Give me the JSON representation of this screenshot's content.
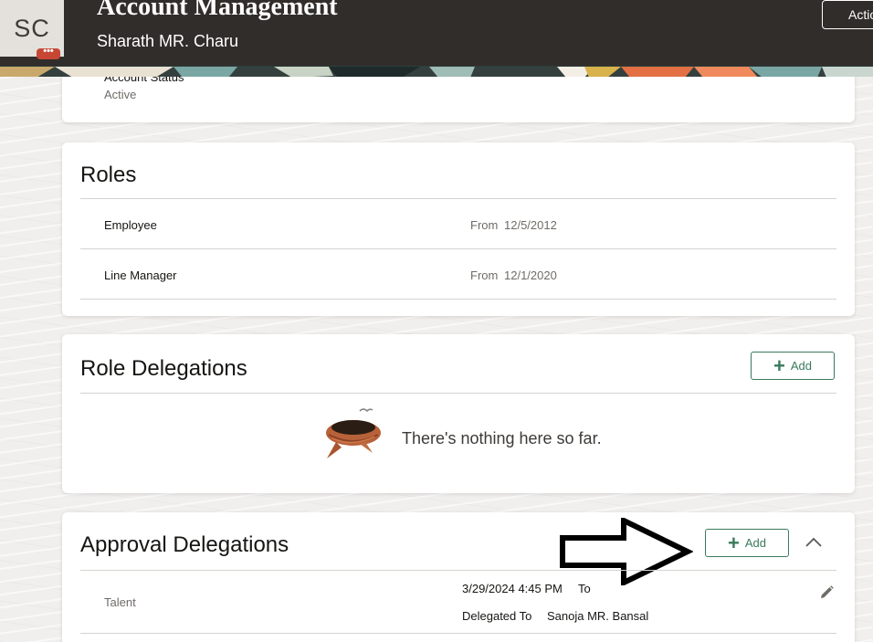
{
  "header": {
    "avatar_initials": "SC",
    "avatar_more": "•••",
    "title": "Account Management",
    "subtitle": "Sharath MR. Charu",
    "actions_label": "Actions"
  },
  "account": {
    "status_label": "Account Status",
    "status_value": "Active"
  },
  "roles": {
    "title": "Roles",
    "items": [
      {
        "name": "Employee",
        "from_label": "From",
        "from_date": "12/5/2012"
      },
      {
        "name": "Line Manager",
        "from_label": "From",
        "from_date": "12/1/2020"
      }
    ]
  },
  "role_delegations": {
    "title": "Role Delegations",
    "add_label": "Add",
    "empty_message": "There's nothing here so far."
  },
  "approval_delegations": {
    "title": "Approval Delegations",
    "add_label": "Add",
    "items": [
      {
        "name": "Talent",
        "datetime": "3/29/2024 4:45 PM",
        "to_label": "To",
        "delegated_label": "Delegated To",
        "delegate": "Sanoja MR. Bansal"
      }
    ]
  }
}
